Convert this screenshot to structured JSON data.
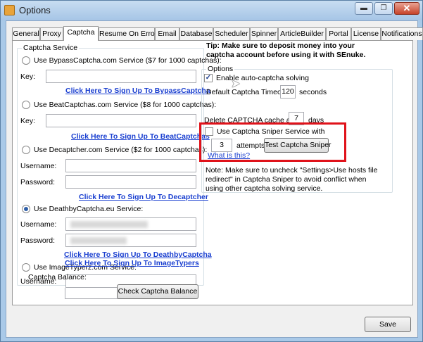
{
  "window": {
    "title": "Options"
  },
  "tabs": [
    "General",
    "Proxy",
    "Captcha",
    "Resume On Error",
    "Email",
    "Database",
    "Scheduler",
    "Spinner",
    "ArticleBuilder",
    "Portal",
    "License",
    "Notifications"
  ],
  "captcha_service": {
    "group_title": "Captcha Service",
    "bypass": {
      "label": "Use BypassCaptcha.com Service ($7 for 1000 captchas):",
      "key_label": "Key:",
      "link": "Click Here To Sign Up To BypassCaptcha"
    },
    "beat": {
      "label": "Use BeatCaptchas.com Service ($8 for 1000 captchas):",
      "key_label": "Key:",
      "link": "Click Here To Sign Up To BeatCaptchas"
    },
    "decaptcher": {
      "label": "Use Decaptcher.com Service ($2 for 1000 captchas):",
      "username_label": "Username:",
      "password_label": "Password:",
      "link": "Click Here To Sign Up To Decaptcher"
    },
    "deathby": {
      "label": "Use DeathbyCaptcha.eu Service:",
      "username_label": "Username:",
      "password_label": "Password:",
      "link": "Click Here To Sign Up To DeathbyCaptcha"
    },
    "imagetyperz": {
      "label": "Use ImageTyperz.com Service:",
      "username_label": "Username:",
      "link": "Click Here To Sign Up To ImageTypers"
    },
    "balance_label": "Captcha Balance:",
    "check_balance_button": "Check Captcha Balance"
  },
  "tip": {
    "line1": "Tip: Make sure to deposit money into your",
    "line2": "captcha account before using it with SEnuke."
  },
  "options": {
    "group_title": "Options",
    "enable_auto": "Enable auto-captcha solving",
    "timeout_label": "Default Captcha Timeout:",
    "timeout_value": "120",
    "timeout_unit": "seconds",
    "delete_cache_label": "Delete CAPTCHA cache after",
    "delete_cache_value": "7",
    "delete_cache_unit": "days"
  },
  "sniper": {
    "checkbox_label": "Use Captcha Sniper Service with",
    "attempts_value": "3",
    "attempts_label": "attempts",
    "test_button": "Test Captcha Sniper",
    "what_link": "What is this?"
  },
  "note": {
    "line1": "Note: Make sure to uncheck \"Settings>Use hosts file",
    "line2": "redirect\" in Captcha Sniper to avoid conflict when",
    "line3": "using other captcha solving service."
  },
  "footer": {
    "save_button": "Save"
  },
  "colors": {
    "highlight": "#e0121a",
    "link": "#1a3fd0"
  }
}
